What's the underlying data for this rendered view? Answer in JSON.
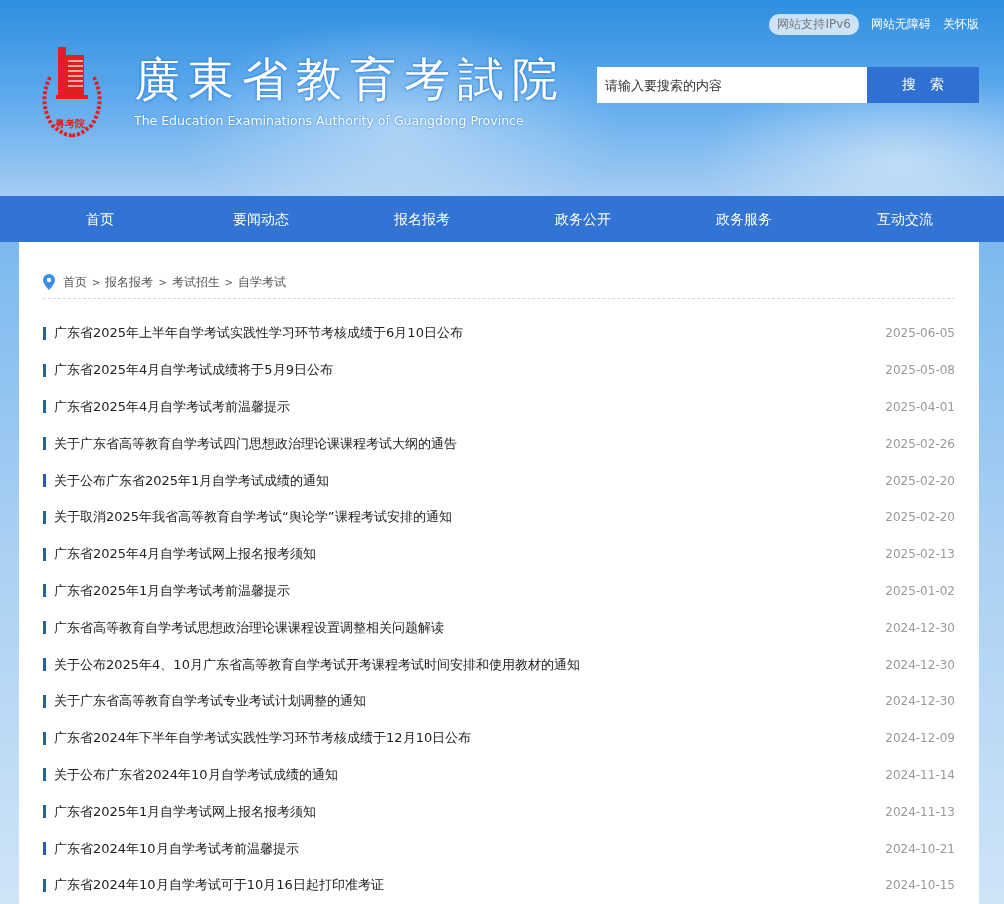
{
  "top_links": {
    "ipv6_badge": "网站支持IPv6",
    "links": [
      "网站无障碍",
      "关怀版"
    ]
  },
  "logo": {
    "emblem_text": "粤考院",
    "title": "廣東省教育考試院",
    "subtitle": "The Education Examinations Authority of Guangdong Province"
  },
  "search": {
    "placeholder": "请输入要搜索的内容",
    "button": "搜　索"
  },
  "nav": [
    {
      "label": "首页",
      "selected": false
    },
    {
      "label": "要闻动态",
      "selected": false
    },
    {
      "label": "报名报考",
      "selected": false
    },
    {
      "label": "政务公开",
      "selected": false
    },
    {
      "label": "政务服务",
      "selected": false
    },
    {
      "label": "互动交流",
      "selected": false
    }
  ],
  "breadcrumb": {
    "separator": ">",
    "items": [
      "首页",
      "报名报考",
      "考试招生",
      "自学考试"
    ]
  },
  "articles": [
    {
      "title": "广东省2025年上半年自学考试实践性学习环节考核成绩于6月10日公布",
      "date": "2025-06-05"
    },
    {
      "title": "广东省2025年4月自学考试成绩将于5月9日公布",
      "date": "2025-05-08"
    },
    {
      "title": "广东省2025年4月自学考试考前温馨提示",
      "date": "2025-04-01"
    },
    {
      "title": "关于广东省高等教育自学考试四门思想政治理论课课程考试大纲的通告",
      "date": "2025-02-26"
    },
    {
      "title": "关于公布广东省2025年1月自学考试成绩的通知",
      "date": "2025-02-20"
    },
    {
      "title": "关于取消2025年我省高等教育自学考试“舆论学”课程考试安排的通知",
      "date": "2025-02-20"
    },
    {
      "title": "广东省2025年4月自学考试网上报名报考须知",
      "date": "2025-02-13"
    },
    {
      "title": "广东省2025年1月自学考试考前温馨提示",
      "date": "2025-01-02"
    },
    {
      "title": "广东省高等教育自学考试思想政治理论课课程设置调整相关问题解读",
      "date": "2024-12-30"
    },
    {
      "title": "关于公布2025年4、10月广东省高等教育自学考试开考课程考试时间安排和使用教材的通知",
      "date": "2024-12-30"
    },
    {
      "title": "关于广东省高等教育自学考试专业考试计划调整的通知",
      "date": "2024-12-30"
    },
    {
      "title": "广东省2024年下半年自学考试实践性学习环节考核成绩于12月10日公布",
      "date": "2024-12-09"
    },
    {
      "title": "关于公布广东省2024年10月自学考试成绩的通知",
      "date": "2024-11-14"
    },
    {
      "title": "广东省2025年1月自学考试网上报名报考须知",
      "date": "2024-11-13"
    },
    {
      "title": "广东省2024年10月自学考试考前温馨提示",
      "date": "2024-10-21"
    },
    {
      "title": "广东省2024年10月自学考试可于10月16日起打印准考证",
      "date": "2024-10-15"
    }
  ]
}
